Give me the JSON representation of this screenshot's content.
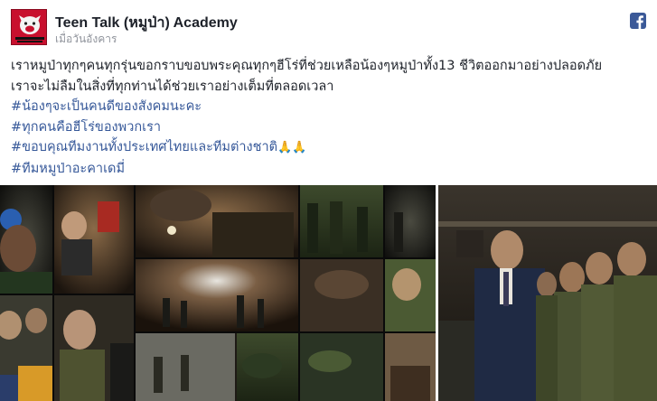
{
  "header": {
    "page_name": "Teen Talk (หมูป่า) Academy",
    "timestamp": "เมื่อวันอังคาร",
    "brand_icon": "facebook-icon",
    "avatar_icon": "teen-talk-logo",
    "brand_color": "#3b5998"
  },
  "post": {
    "lines": [
      "เราหมูป่าทุกๆคนทุกรุ่นขอกราบขอบพระคุณทุกๆฮีโร่ที่ช่วยเหลือน้องๆหมูป่าทั้ง13 ชีวิตออกมาอย่างปลอดภัย",
      "เราจะไม่ลืมในสิ่งที่ทุกท่านได้ช่วยเราอย่างเต็มที่ตลอดเวลา"
    ],
    "hashtags": [
      "#น้องๆจะเป็นคนดีของสังคมนะคะ",
      "#ทุกคนคือฮีโร่ของพวกเรา",
      "#ขอบคุณทีมงานทั้งประเทศไทยและทีมต่างชาติ",
      "#ทีมหมูป่าอะคาเดมี่"
    ],
    "emoji": "🙏🙏",
    "hashtag_color": "#365899"
  },
  "media": {
    "collage_label": "rescue-collage-image",
    "right_label": "officials-line-image"
  }
}
